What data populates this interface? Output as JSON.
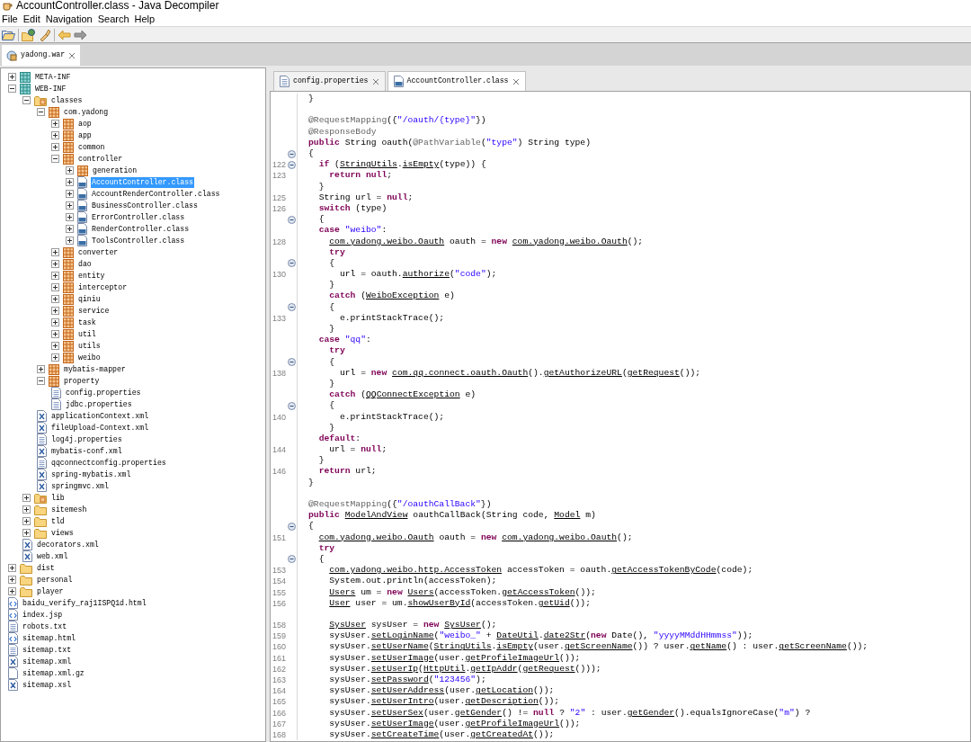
{
  "window": {
    "title": "AccountController.class - Java Decompiler"
  },
  "menu": [
    "File",
    "Edit",
    "Navigation",
    "Search",
    "Help"
  ],
  "navigation": [
    {
      "disabled": false
    },
    {
      "disabled": true
    }
  ],
  "archive_tabs": [
    {
      "label": "yadong.war",
      "selected": true
    }
  ],
  "tree": [
    {
      "label": "META-INF",
      "kind": "module",
      "expanded": false,
      "selected": false
    },
    {
      "label": "WEB-INF",
      "kind": "module",
      "expanded": true,
      "selected": false,
      "children": [
        {
          "label": "classes",
          "kind": "source-folder",
          "expanded": true,
          "selected": false,
          "children": [
            {
              "label": "com.yadong",
              "kind": "package",
              "expanded": true,
              "selected": false,
              "children": [
                {
                  "label": "aop",
                  "kind": "package",
                  "expanded": false,
                  "selected": false
                },
                {
                  "label": "app",
                  "kind": "package",
                  "expanded": false,
                  "selected": false
                },
                {
                  "label": "common",
                  "kind": "package",
                  "expanded": false,
                  "selected": false
                },
                {
                  "label": "controller",
                  "kind": "package",
                  "expanded": true,
                  "selected": false,
                  "children": [
                    {
                      "label": "generation",
                      "kind": "package",
                      "expanded": false,
                      "selected": false
                    },
                    {
                      "label": "AccountController.class",
                      "kind": "class",
                      "expanded": false,
                      "selected": true
                    },
                    {
                      "label": "AccountRenderController.class",
                      "kind": "class",
                      "expanded": false,
                      "selected": false
                    },
                    {
                      "label": "BusinessController.class",
                      "kind": "class",
                      "expanded": false,
                      "selected": false
                    },
                    {
                      "label": "ErrorController.class",
                      "kind": "class",
                      "expanded": false,
                      "selected": false
                    },
                    {
                      "label": "RenderController.class",
                      "kind": "class",
                      "expanded": false,
                      "selected": false
                    },
                    {
                      "label": "ToolsController.class",
                      "kind": "class",
                      "expanded": false,
                      "selected": false
                    }
                  ]
                },
                {
                  "label": "converter",
                  "kind": "package",
                  "expanded": false,
                  "selected": false
                },
                {
                  "label": "dao",
                  "kind": "package",
                  "expanded": false,
                  "selected": false
                },
                {
                  "label": "entity",
                  "kind": "package",
                  "expanded": false,
                  "selected": false
                },
                {
                  "label": "interceptor",
                  "kind": "package",
                  "expanded": false,
                  "selected": false
                },
                {
                  "label": "qiniu",
                  "kind": "package",
                  "expanded": false,
                  "selected": false
                },
                {
                  "label": "service",
                  "kind": "package",
                  "expanded": false,
                  "selected": false
                },
                {
                  "label": "task",
                  "kind": "package",
                  "expanded": false,
                  "selected": false
                },
                {
                  "label": "util",
                  "kind": "package",
                  "expanded": false,
                  "selected": false
                },
                {
                  "label": "utils",
                  "kind": "package",
                  "expanded": false,
                  "selected": false
                },
                {
                  "label": "weibo",
                  "kind": "package",
                  "expanded": false,
                  "selected": false
                }
              ]
            },
            {
              "label": "mybatis-mapper",
              "kind": "package",
              "expanded": false,
              "selected": false
            },
            {
              "label": "property",
              "kind": "package",
              "expanded": true,
              "selected": false,
              "children": [
                {
                  "label": "config.properties",
                  "kind": "properties",
                  "selected": false
                },
                {
                  "label": "jdbc.properties",
                  "kind": "properties",
                  "selected": false
                }
              ]
            },
            {
              "label": "applicationContext.xml",
              "kind": "xml",
              "selected": false
            },
            {
              "label": "fileUpload-Context.xml",
              "kind": "xml",
              "selected": false
            },
            {
              "label": "log4j.properties",
              "kind": "properties",
              "selected": false
            },
            {
              "label": "mybatis-conf.xml",
              "kind": "xml",
              "selected": false
            },
            {
              "label": "qqconnectconfig.properties",
              "kind": "properties",
              "selected": false
            },
            {
              "label": "spring-mybatis.xml",
              "kind": "xml",
              "selected": false
            },
            {
              "label": "springmvc.xml",
              "kind": "xml",
              "selected": false
            }
          ]
        },
        {
          "label": "lib",
          "kind": "source-folder",
          "expanded": false,
          "selected": false
        },
        {
          "label": "sitemesh",
          "kind": "folder",
          "expanded": false,
          "selected": false
        },
        {
          "label": "tld",
          "kind": "folder",
          "expanded": false,
          "selected": false
        },
        {
          "label": "views",
          "kind": "folder",
          "expanded": false,
          "selected": false
        },
        {
          "label": "decorators.xml",
          "kind": "xml",
          "selected": false
        },
        {
          "label": "web.xml",
          "kind": "xml",
          "selected": false
        }
      ]
    },
    {
      "label": "dist",
      "kind": "folder",
      "expanded": false,
      "selected": false
    },
    {
      "label": "personal",
      "kind": "folder",
      "expanded": false,
      "selected": false
    },
    {
      "label": "player",
      "kind": "folder",
      "expanded": false,
      "selected": false
    },
    {
      "label": "baidu_verify_raj1ISPQ1d.html",
      "kind": "html",
      "selected": false
    },
    {
      "label": "index.jsp",
      "kind": "html",
      "selected": false
    },
    {
      "label": "robots.txt",
      "kind": "properties",
      "selected": false
    },
    {
      "label": "sitemap.html",
      "kind": "html",
      "selected": false
    },
    {
      "label": "sitemap.txt",
      "kind": "properties",
      "selected": false
    },
    {
      "label": "sitemap.xml",
      "kind": "xml",
      "selected": false
    },
    {
      "label": "sitemap.xml.gz",
      "kind": "file",
      "selected": false
    },
    {
      "label": "sitemap.xsl",
      "kind": "xml",
      "selected": false
    }
  ],
  "editor_tabs": [
    {
      "label": "config.properties",
      "kind": "properties",
      "selected": false
    },
    {
      "label": "AccountController.class",
      "kind": "class",
      "selected": true
    }
  ],
  "code": [
    {
      "kind": "code",
      "segs": [
        {
          "kind": "plain",
          "text": "}"
        }
      ]
    },
    {
      "kind": "blank"
    },
    {
      "kind": "code",
      "segs": [
        {
          "kind": "annotation",
          "text": "@RequestMapping"
        },
        {
          "kind": "plain",
          "text": "({"
        },
        {
          "kind": "string",
          "text": "\"/oauth/{type}\""
        },
        {
          "kind": "plain",
          "text": "})"
        }
      ]
    },
    {
      "kind": "code",
      "segs": [
        {
          "kind": "annotation",
          "text": "@ResponseBody"
        }
      ]
    },
    {
      "kind": "code",
      "segs": [
        {
          "kind": "keyword",
          "text": "public"
        },
        {
          "kind": "plain",
          "text": " String oauth("
        },
        {
          "kind": "annotation",
          "text": "@PathVariable"
        },
        {
          "kind": "plain",
          "text": "("
        },
        {
          "kind": "string",
          "text": "\"type\""
        },
        {
          "kind": "plain",
          "text": ") String type)"
        }
      ]
    },
    {
      "kind": "code",
      "fold": true,
      "segs": [
        {
          "kind": "plain",
          "text": "{"
        }
      ]
    },
    {
      "kind": "code",
      "num": "122",
      "fold": true,
      "segs": [
        {
          "kind": "keyword",
          "text": "  if"
        },
        {
          "kind": "plain",
          "text": " ("
        },
        {
          "kind": "reference",
          "text": "StringUtils"
        },
        {
          "kind": "plain",
          "text": "."
        },
        {
          "kind": "reference",
          "text": "isEmpty"
        },
        {
          "kind": "plain",
          "text": "(type)) {"
        }
      ]
    },
    {
      "kind": "code",
      "num": "123",
      "segs": [
        {
          "kind": "keyword",
          "text": "    return null"
        },
        {
          "kind": "plain",
          "text": ";"
        }
      ]
    },
    {
      "kind": "code",
      "segs": [
        {
          "kind": "plain",
          "text": "  }"
        }
      ]
    },
    {
      "kind": "code",
      "num": "125",
      "segs": [
        {
          "kind": "plain",
          "text": "  String url = "
        },
        {
          "kind": "keyword",
          "text": "null"
        },
        {
          "kind": "plain",
          "text": ";"
        }
      ]
    },
    {
      "kind": "code",
      "num": "126",
      "segs": [
        {
          "kind": "keyword",
          "text": "  switch"
        },
        {
          "kind": "plain",
          "text": " (type)"
        }
      ]
    },
    {
      "kind": "code",
      "fold": true,
      "segs": [
        {
          "kind": "plain",
          "text": "  {"
        }
      ]
    },
    {
      "kind": "code",
      "segs": [
        {
          "kind": "keyword",
          "text": "  case"
        },
        {
          "kind": "string",
          "text": " \"weibo\""
        },
        {
          "kind": "plain",
          "text": ":"
        }
      ]
    },
    {
      "kind": "code",
      "num": "128",
      "segs": [
        {
          "kind": "reference",
          "text": "    com.yadong.weibo.Oauth"
        },
        {
          "kind": "plain",
          "text": " oauth = "
        },
        {
          "kind": "keyword",
          "text": "new"
        },
        {
          "kind": "reference",
          "text": " com.yadong.weibo.Oauth"
        },
        {
          "kind": "plain",
          "text": "();"
        }
      ]
    },
    {
      "kind": "code",
      "segs": [
        {
          "kind": "keyword",
          "text": "    try"
        }
      ]
    },
    {
      "kind": "code",
      "fold": true,
      "segs": [
        {
          "kind": "plain",
          "text": "    {"
        }
      ]
    },
    {
      "kind": "code",
      "num": "130",
      "segs": [
        {
          "kind": "plain",
          "text": "      url = oauth."
        },
        {
          "kind": "reference",
          "text": "authorize"
        },
        {
          "kind": "plain",
          "text": "("
        },
        {
          "kind": "string",
          "text": "\"code\""
        },
        {
          "kind": "plain",
          "text": ");"
        }
      ]
    },
    {
      "kind": "code",
      "segs": [
        {
          "kind": "plain",
          "text": "    }"
        }
      ]
    },
    {
      "kind": "code",
      "segs": [
        {
          "kind": "keyword",
          "text": "    catch"
        },
        {
          "kind": "plain",
          "text": " ("
        },
        {
          "kind": "reference",
          "text": "WeiboException"
        },
        {
          "kind": "plain",
          "text": " e)"
        }
      ]
    },
    {
      "kind": "code",
      "fold": true,
      "segs": [
        {
          "kind": "plain",
          "text": "    {"
        }
      ]
    },
    {
      "kind": "code",
      "num": "133",
      "segs": [
        {
          "kind": "plain",
          "text": "      e.printStackTrace();"
        }
      ]
    },
    {
      "kind": "code",
      "segs": [
        {
          "kind": "plain",
          "text": "    }"
        }
      ]
    },
    {
      "kind": "code",
      "segs": [
        {
          "kind": "keyword",
          "text": "  case"
        },
        {
          "kind": "string",
          "text": " \"qq\""
        },
        {
          "kind": "plain",
          "text": ":"
        }
      ]
    },
    {
      "kind": "code",
      "segs": [
        {
          "kind": "keyword",
          "text": "    try"
        }
      ]
    },
    {
      "kind": "code",
      "fold": true,
      "segs": [
        {
          "kind": "plain",
          "text": "    {"
        }
      ]
    },
    {
      "kind": "code",
      "num": "138",
      "segs": [
        {
          "kind": "plain",
          "text": "      url = "
        },
        {
          "kind": "keyword",
          "text": "new"
        },
        {
          "kind": "reference",
          "text": " com.qq.connect.oauth.Oauth"
        },
        {
          "kind": "plain",
          "text": "()."
        },
        {
          "kind": "reference",
          "text": "getAuthorizeURL"
        },
        {
          "kind": "plain",
          "text": "("
        },
        {
          "kind": "reference",
          "text": "getRequest"
        },
        {
          "kind": "plain",
          "text": "());"
        }
      ]
    },
    {
      "kind": "code",
      "segs": [
        {
          "kind": "plain",
          "text": "    }"
        }
      ]
    },
    {
      "kind": "code",
      "segs": [
        {
          "kind": "keyword",
          "text": "    catch"
        },
        {
          "kind": "plain",
          "text": " ("
        },
        {
          "kind": "reference",
          "text": "QQConnectException"
        },
        {
          "kind": "plain",
          "text": " e)"
        }
      ]
    },
    {
      "kind": "code",
      "fold": true,
      "segs": [
        {
          "kind": "plain",
          "text": "    {"
        }
      ]
    },
    {
      "kind": "code",
      "num": "140",
      "segs": [
        {
          "kind": "plain",
          "text": "      e.printStackTrace();"
        }
      ]
    },
    {
      "kind": "code",
      "segs": [
        {
          "kind": "plain",
          "text": "    }"
        }
      ]
    },
    {
      "kind": "code",
      "segs": [
        {
          "kind": "keyword",
          "text": "  default"
        },
        {
          "kind": "plain",
          "text": ":"
        }
      ]
    },
    {
      "kind": "code",
      "num": "144",
      "segs": [
        {
          "kind": "plain",
          "text": "    url = "
        },
        {
          "kind": "keyword",
          "text": "null"
        },
        {
          "kind": "plain",
          "text": ";"
        }
      ]
    },
    {
      "kind": "code",
      "segs": [
        {
          "kind": "plain",
          "text": "  }"
        }
      ]
    },
    {
      "kind": "code",
      "num": "146",
      "segs": [
        {
          "kind": "keyword",
          "text": "  return"
        },
        {
          "kind": "plain",
          "text": " url;"
        }
      ]
    },
    {
      "kind": "code",
      "segs": [
        {
          "kind": "plain",
          "text": "}"
        }
      ]
    },
    {
      "kind": "blank"
    },
    {
      "kind": "code",
      "segs": [
        {
          "kind": "annotation",
          "text": "@RequestMapping"
        },
        {
          "kind": "plain",
          "text": "({"
        },
        {
          "kind": "string",
          "text": "\"/oauthCallBack\""
        },
        {
          "kind": "plain",
          "text": "})"
        }
      ]
    },
    {
      "kind": "code",
      "segs": [
        {
          "kind": "keyword",
          "text": "public"
        },
        {
          "kind": "reference",
          "text": " ModelAndView"
        },
        {
          "kind": "plain",
          "text": " oauthCallBack(String code,"
        },
        {
          "kind": "reference",
          "text": " Model"
        },
        {
          "kind": "plain",
          "text": " m)"
        }
      ]
    },
    {
      "kind": "code",
      "fold": true,
      "segs": [
        {
          "kind": "plain",
          "text": "{"
        }
      ]
    },
    {
      "kind": "code",
      "num": "151",
      "segs": [
        {
          "kind": "reference",
          "text": "  com.yadong.weibo.Oauth"
        },
        {
          "kind": "plain",
          "text": " oauth = "
        },
        {
          "kind": "keyword",
          "text": "new"
        },
        {
          "kind": "reference",
          "text": " com.yadong.weibo.Oauth"
        },
        {
          "kind": "plain",
          "text": "();"
        }
      ]
    },
    {
      "kind": "code",
      "segs": [
        {
          "kind": "keyword",
          "text": "  try"
        }
      ]
    },
    {
      "kind": "code",
      "fold": true,
      "segs": [
        {
          "kind": "plain",
          "text": "  {"
        }
      ]
    },
    {
      "kind": "code",
      "num": "153",
      "segs": [
        {
          "kind": "reference",
          "text": "    com.yadong.weibo.http.AccessToken"
        },
        {
          "kind": "plain",
          "text": " accessToken = oauth."
        },
        {
          "kind": "reference",
          "text": "getAccessTokenByCode"
        },
        {
          "kind": "plain",
          "text": "(code);"
        }
      ]
    },
    {
      "kind": "code",
      "num": "154",
      "segs": [
        {
          "kind": "plain",
          "text": "    System.out.println(accessToken);"
        }
      ]
    },
    {
      "kind": "code",
      "num": "155",
      "segs": [
        {
          "kind": "reference",
          "text": "    Users"
        },
        {
          "kind": "plain",
          "text": " um = "
        },
        {
          "kind": "keyword",
          "text": "new"
        },
        {
          "kind": "reference",
          "text": " Users"
        },
        {
          "kind": "plain",
          "text": "(accessToken."
        },
        {
          "kind": "reference",
          "text": "getAccessToken"
        },
        {
          "kind": "plain",
          "text": "());"
        }
      ]
    },
    {
      "kind": "code",
      "num": "156",
      "segs": [
        {
          "kind": "reference",
          "text": "    User"
        },
        {
          "kind": "plain",
          "text": " user = um."
        },
        {
          "kind": "reference",
          "text": "showUserById"
        },
        {
          "kind": "plain",
          "text": "(accessToken."
        },
        {
          "kind": "reference",
          "text": "getUid"
        },
        {
          "kind": "plain",
          "text": "());"
        }
      ]
    },
    {
      "kind": "blank"
    },
    {
      "kind": "code",
      "num": "158",
      "segs": [
        {
          "kind": "reference",
          "text": "    SysUser"
        },
        {
          "kind": "plain",
          "text": " sysUser = "
        },
        {
          "kind": "keyword",
          "text": "new"
        },
        {
          "kind": "reference",
          "text": " SysUser"
        },
        {
          "kind": "plain",
          "text": "();"
        }
      ]
    },
    {
      "kind": "code",
      "num": "159",
      "segs": [
        {
          "kind": "plain",
          "text": "    sysUser."
        },
        {
          "kind": "reference",
          "text": "setLoginName"
        },
        {
          "kind": "plain",
          "text": "("
        },
        {
          "kind": "string",
          "text": "\"weibo_\""
        },
        {
          "kind": "plain",
          "text": " + "
        },
        {
          "kind": "reference",
          "text": "DateUtil"
        },
        {
          "kind": "plain",
          "text": "."
        },
        {
          "kind": "reference",
          "text": "date2Str"
        },
        {
          "kind": "plain",
          "text": "("
        },
        {
          "kind": "keyword",
          "text": "new"
        },
        {
          "kind": "plain",
          "text": " Date(), "
        },
        {
          "kind": "string",
          "text": "\"yyyyMMddHHmmss\""
        },
        {
          "kind": "plain",
          "text": "));"
        }
      ]
    },
    {
      "kind": "code",
      "num": "160",
      "segs": [
        {
          "kind": "plain",
          "text": "    sysUser."
        },
        {
          "kind": "reference",
          "text": "setUserName"
        },
        {
          "kind": "plain",
          "text": "("
        },
        {
          "kind": "reference",
          "text": "StringUtils"
        },
        {
          "kind": "plain",
          "text": "."
        },
        {
          "kind": "reference",
          "text": "isEmpty"
        },
        {
          "kind": "plain",
          "text": "(user."
        },
        {
          "kind": "reference",
          "text": "getScreenName"
        },
        {
          "kind": "plain",
          "text": "()) ? user."
        },
        {
          "kind": "reference",
          "text": "getName"
        },
        {
          "kind": "plain",
          "text": "() : user."
        },
        {
          "kind": "reference",
          "text": "getScreenName"
        },
        {
          "kind": "plain",
          "text": "());"
        }
      ]
    },
    {
      "kind": "code",
      "num": "161",
      "segs": [
        {
          "kind": "plain",
          "text": "    sysUser."
        },
        {
          "kind": "reference",
          "text": "setUserImage"
        },
        {
          "kind": "plain",
          "text": "(user."
        },
        {
          "kind": "reference",
          "text": "getProfileImageUrl"
        },
        {
          "kind": "plain",
          "text": "());"
        }
      ]
    },
    {
      "kind": "code",
      "num": "162",
      "segs": [
        {
          "kind": "plain",
          "text": "    sysUser."
        },
        {
          "kind": "reference",
          "text": "setUserIp"
        },
        {
          "kind": "plain",
          "text": "("
        },
        {
          "kind": "reference",
          "text": "HttpUtil"
        },
        {
          "kind": "plain",
          "text": "."
        },
        {
          "kind": "reference",
          "text": "getIpAddr"
        },
        {
          "kind": "plain",
          "text": "("
        },
        {
          "kind": "reference",
          "text": "getRequest"
        },
        {
          "kind": "plain",
          "text": "()));"
        }
      ]
    },
    {
      "kind": "code",
      "num": "163",
      "segs": [
        {
          "kind": "plain",
          "text": "    sysUser."
        },
        {
          "kind": "reference",
          "text": "setPassword"
        },
        {
          "kind": "plain",
          "text": "("
        },
        {
          "kind": "string",
          "text": "\"123456\""
        },
        {
          "kind": "plain",
          "text": ");"
        }
      ]
    },
    {
      "kind": "code",
      "num": "164",
      "segs": [
        {
          "kind": "plain",
          "text": "    sysUser."
        },
        {
          "kind": "reference",
          "text": "setUserAddress"
        },
        {
          "kind": "plain",
          "text": "(user."
        },
        {
          "kind": "reference",
          "text": "getLocation"
        },
        {
          "kind": "plain",
          "text": "());"
        }
      ]
    },
    {
      "kind": "code",
      "num": "165",
      "segs": [
        {
          "kind": "plain",
          "text": "    sysUser."
        },
        {
          "kind": "reference",
          "text": "setUserIntro"
        },
        {
          "kind": "plain",
          "text": "(user."
        },
        {
          "kind": "reference",
          "text": "getDescription"
        },
        {
          "kind": "plain",
          "text": "());"
        }
      ]
    },
    {
      "kind": "code",
      "num": "166",
      "segs": [
        {
          "kind": "plain",
          "text": "    sysUser."
        },
        {
          "kind": "reference",
          "text": "setUserSex"
        },
        {
          "kind": "plain",
          "text": "(user."
        },
        {
          "kind": "reference",
          "text": "getGender"
        },
        {
          "kind": "plain",
          "text": "() != "
        },
        {
          "kind": "keyword",
          "text": "null"
        },
        {
          "kind": "plain",
          "text": " ? "
        },
        {
          "kind": "string",
          "text": "\"2\""
        },
        {
          "kind": "plain",
          "text": " : user."
        },
        {
          "kind": "reference",
          "text": "getGender"
        },
        {
          "kind": "plain",
          "text": "().equalsIgnoreCase("
        },
        {
          "kind": "string",
          "text": "\"m\""
        },
        {
          "kind": "plain",
          "text": ") ?"
        }
      ]
    },
    {
      "kind": "code",
      "num": "167",
      "segs": [
        {
          "kind": "plain",
          "text": "    sysUser."
        },
        {
          "kind": "reference",
          "text": "setUserImage"
        },
        {
          "kind": "plain",
          "text": "(user."
        },
        {
          "kind": "reference",
          "text": "getProfileImageUrl"
        },
        {
          "kind": "plain",
          "text": "());"
        }
      ]
    },
    {
      "kind": "code",
      "num": "168",
      "segs": [
        {
          "kind": "plain",
          "text": "    sysUser."
        },
        {
          "kind": "reference",
          "text": "setCreateTime"
        },
        {
          "kind": "plain",
          "text": "(user."
        },
        {
          "kind": "reference",
          "text": "getCreatedAt"
        },
        {
          "kind": "plain",
          "text": "());"
        }
      ]
    }
  ]
}
